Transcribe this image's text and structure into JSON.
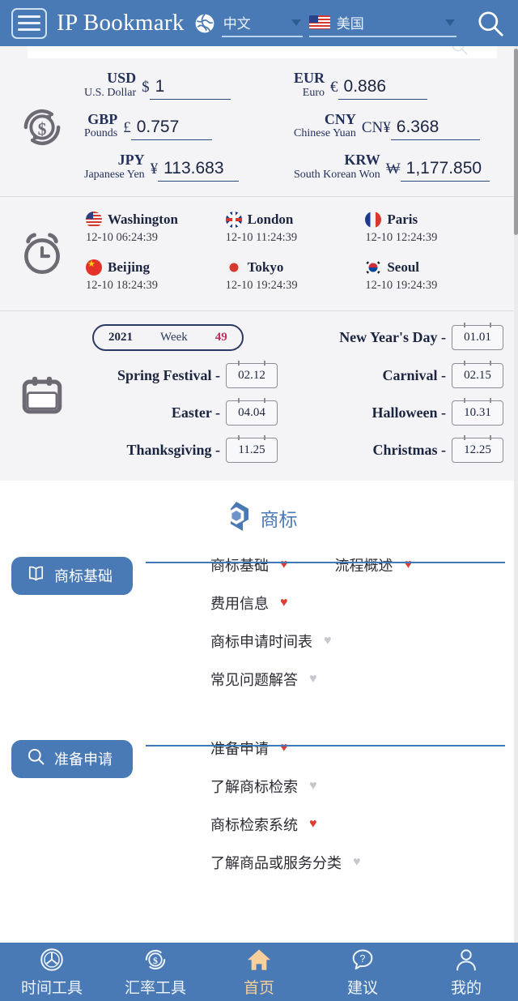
{
  "header": {
    "brand": "IP Bookmark",
    "menu_icon": "hamburger-icon",
    "globe_icon": "globe-icon",
    "language": "中文",
    "country": "美国",
    "search_icon": "search-icon"
  },
  "currency": {
    "icon": "currency-exchange-icon",
    "rows": [
      {
        "left": {
          "code": "USD",
          "name": "U.S. Dollar",
          "symbol": "$",
          "value": "1"
        },
        "right": {
          "code": "EUR",
          "name": "Euro",
          "symbol": "€",
          "value": "0.886"
        }
      },
      {
        "left": {
          "code": "GBP",
          "name": "Pounds",
          "symbol": "£",
          "value": "0.757"
        },
        "right": {
          "code": "CNY",
          "name": "Chinese Yuan",
          "symbol": "CN¥",
          "value": "6.368"
        }
      },
      {
        "left": {
          "code": "JPY",
          "name": "Japanese Yen",
          "symbol": "¥",
          "value": "113.683"
        },
        "right": {
          "code": "KRW",
          "name": "South Korean Won",
          "symbol": "₩",
          "value": "1,177.850"
        }
      }
    ]
  },
  "clock": {
    "icon": "alarm-clock-icon",
    "cities": [
      {
        "name": "Washington",
        "time": "12-10 06:24:39",
        "flag": "flag-us"
      },
      {
        "name": "London",
        "time": "12-10 11:24:39",
        "flag": "flag-uk"
      },
      {
        "name": "Paris",
        "time": "12-10 12:24:39",
        "flag": "flag-fr"
      },
      {
        "name": "Beijing",
        "time": "12-10 18:24:39",
        "flag": "flag-cn"
      },
      {
        "name": "Tokyo",
        "time": "12-10 19:24:39",
        "flag": "flag-jp"
      },
      {
        "name": "Seoul",
        "time": "12-10 19:24:39",
        "flag": "flag-kr"
      }
    ]
  },
  "calendar": {
    "icon": "calendar-icon",
    "year": "2021",
    "week_label": "Week",
    "week_number": "49",
    "holidays": [
      {
        "label": "New Year's Day -",
        "date": "01.01"
      },
      {
        "label": "Spring Festival -",
        "date": "02.12"
      },
      {
        "label": "Carnival -",
        "date": "02.15"
      },
      {
        "label": "Easter -",
        "date": "04.04"
      },
      {
        "label": "Halloween -",
        "date": "10.31"
      },
      {
        "label": "Thanksgiving -",
        "date": "11.25"
      },
      {
        "label": "Christmas -",
        "date": "12.25"
      }
    ]
  },
  "trademark": {
    "logo_icon": "hexagon-logo-icon",
    "title": "商标",
    "groups": [
      {
        "badge": "商标基础",
        "badge_icon": "book-icon",
        "rows": [
          [
            {
              "label": "商标基础",
              "favorite": true
            },
            {
              "label": "流程概述",
              "favorite": true
            }
          ],
          [
            {
              "label": "费用信息",
              "favorite": true
            }
          ],
          [
            {
              "label": "商标申请时间表",
              "favorite": false
            }
          ],
          [
            {
              "label": "常见问题解答",
              "favorite": false
            }
          ]
        ]
      },
      {
        "badge": "准备申请",
        "badge_icon": "search-icon",
        "rows": [
          [
            {
              "label": "准备申请",
              "favorite": true
            }
          ],
          [
            {
              "label": "了解商标检索",
              "favorite": false
            }
          ],
          [
            {
              "label": "商标检索系统",
              "favorite": true
            }
          ],
          [
            {
              "label": "了解商品或服务分类",
              "favorite": false
            }
          ]
        ]
      }
    ]
  },
  "bottom_nav": {
    "items": [
      {
        "label": "时间工具",
        "icon": "clock-tool-icon",
        "active": false
      },
      {
        "label": "汇率工具",
        "icon": "currency-tool-icon",
        "active": false
      },
      {
        "label": "首页",
        "icon": "home-icon",
        "active": true
      },
      {
        "label": "建议",
        "icon": "feedback-icon",
        "active": false
      },
      {
        "label": "我的",
        "icon": "profile-icon",
        "active": false
      }
    ]
  },
  "colors": {
    "brand_blue": "#4a7ab5",
    "panel_bg": "#f4f3f6",
    "accent_navy": "#1b2540",
    "heart_on": "#e03b30",
    "heart_off": "#c6c6cc",
    "home_active": "#f9cf9c",
    "week_number": "#b8325a"
  }
}
